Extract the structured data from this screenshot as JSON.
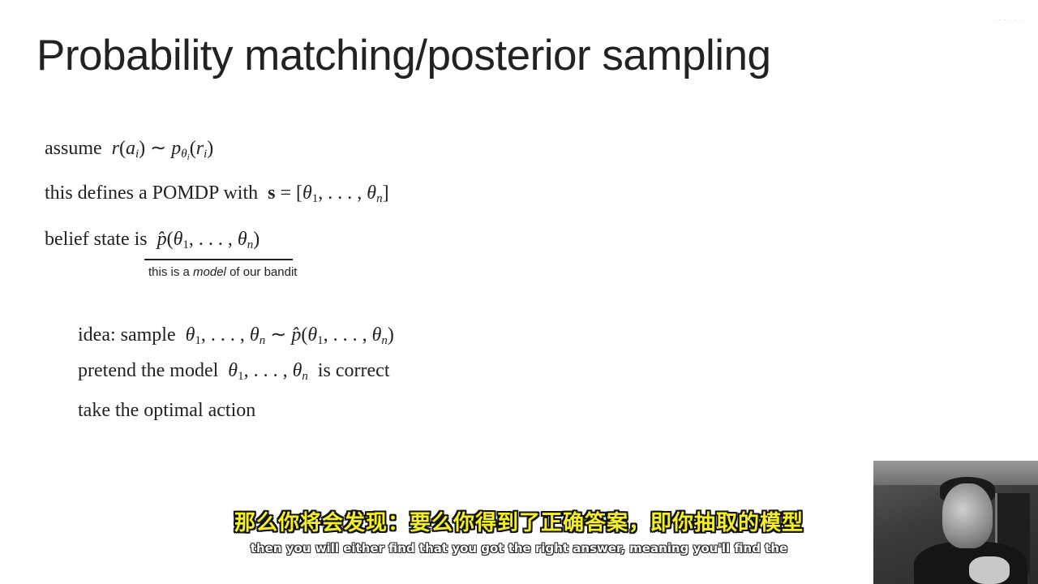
{
  "slide": {
    "title": "Probability matching/posterior sampling",
    "corner_mark": "· · · ·  ·  ·",
    "lines": {
      "assume_word": "assume",
      "defines_text": "this defines a POMDP with",
      "belief_text": "belief state is",
      "idea_text": "idea: sample",
      "pretend_text": "pretend the model",
      "pretend_suffix": "is correct",
      "take_text": "take the optimal action"
    },
    "annotation": {
      "prefix": "this is a",
      "emphasis": "model",
      "suffix": "of our bandit"
    }
  },
  "subtitles": {
    "chinese": "那么你将会发现：要么你得到了正确答案，即你抽取的模型",
    "english": "then you will either find that you got the right answer, meaning you'll find the"
  }
}
